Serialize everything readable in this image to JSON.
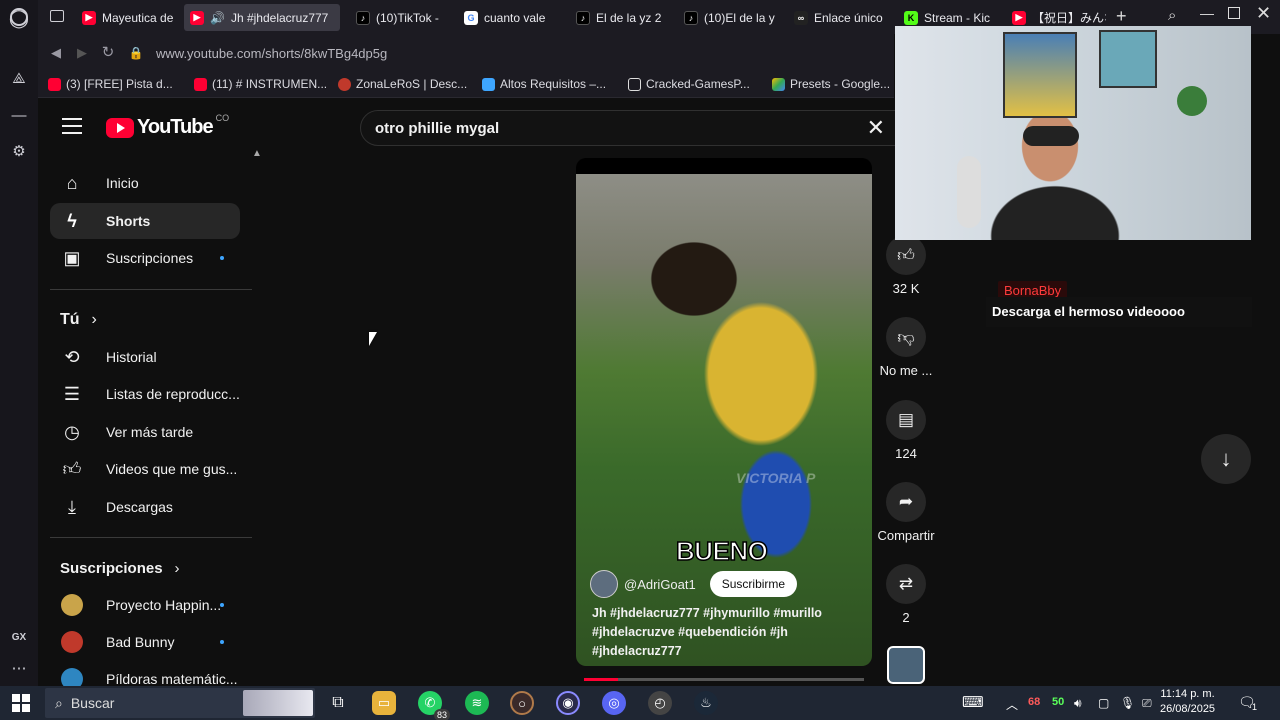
{
  "browser": {
    "tabs": [
      {
        "label": "Mayeutica de",
        "icon": "youtube-icon"
      },
      {
        "label": "Jh #jhdelacruz777",
        "icon": "youtube-icon",
        "active": true
      },
      {
        "label": "(10)TikTok -",
        "icon": "tiktok-icon"
      },
      {
        "label": "cuanto vale",
        "icon": "google-icon"
      },
      {
        "label": "El de la yz 2",
        "icon": "tiktok-icon"
      },
      {
        "label": "(10)El de la y",
        "icon": "tiktok-icon"
      },
      {
        "label": "Enlace único",
        "icon": "link-icon"
      },
      {
        "label": "Stream - Kic",
        "icon": "kick-icon"
      },
      {
        "label": "【祝日】みんな",
        "icon": "youtube-icon"
      }
    ],
    "url": "www.youtube.com/shorts/8kwTBg4dp5g",
    "bookmarks": [
      "(3) [FREE] Pista d...",
      "(11) # INSTRUMEN...",
      "ZonaLeRoS | Desc...",
      "Altos Requisitos –...",
      "Cracked-GamesP...",
      "Presets - Google..."
    ]
  },
  "youtube": {
    "logo_text": "YouTube",
    "logo_country": "CO",
    "search_value": "otro phillie mygal",
    "sidebar": {
      "main": [
        {
          "label": "Inicio",
          "icon": "home-icon"
        },
        {
          "label": "Shorts",
          "icon": "shorts-icon",
          "active": true
        },
        {
          "label": "Suscripciones",
          "icon": "subscriptions-icon"
        }
      ],
      "you_heading": "Tú",
      "you": [
        {
          "label": "Historial",
          "icon": "history-icon"
        },
        {
          "label": "Listas de reproducc...",
          "icon": "playlist-icon"
        },
        {
          "label": "Ver más tarde",
          "icon": "watch-later-icon"
        },
        {
          "label": "Videos que me gus...",
          "icon": "like-icon"
        },
        {
          "label": "Descargas",
          "icon": "download-icon"
        }
      ],
      "subs_heading": "Suscripciones",
      "subs": [
        {
          "label": "Proyecto Happin...",
          "color": "#c9a44a"
        },
        {
          "label": "Bad Bunny",
          "color": "#c0392b"
        },
        {
          "label": "Píldoras matemátic...",
          "color": "#2e86c1"
        }
      ]
    },
    "short": {
      "overlay_text": "BUENO",
      "channel": "@AdriGoat1",
      "subscribe": "Suscribirme",
      "caption": "Jh #jhdelacruz777 #jhymurillo #murillo #jhdelacruzve #quebendición #jh #jhdelacruz777",
      "watermark": "VICTORIA P",
      "progress": 0.12
    },
    "actions": {
      "likes": "32 K",
      "dislike": "No me ...",
      "comments": "124",
      "share": "Compartir",
      "remix": "2"
    }
  },
  "stream_overlay": {
    "chat_user": "BornaBby",
    "chat_message": "Descarga el hermoso videoooo"
  },
  "taskbar": {
    "search_placeholder": "Buscar",
    "whatsapp_badge": "83",
    "tray_numbers": [
      "68",
      "50"
    ],
    "time": "11:14 p. m.",
    "date": "26/08/2025",
    "notif": "1"
  },
  "colors": {
    "youtube_red": "#ff0033",
    "accent_blue": "#3ea6ff",
    "chat_user": "#ff3b3b"
  }
}
